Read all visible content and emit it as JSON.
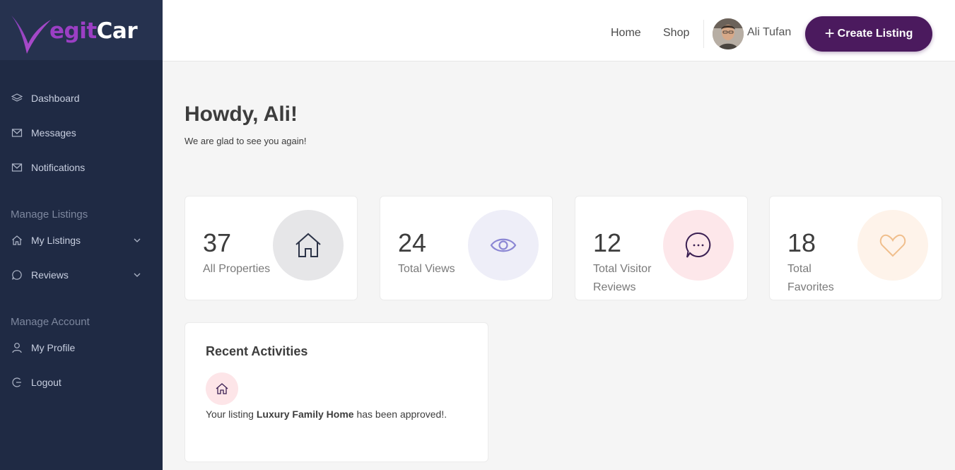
{
  "brand": {
    "logo_part1": "egit",
    "logo_part2": "Car"
  },
  "sidebar": {
    "items_top": [
      {
        "label": "Dashboard",
        "icon": "layers-icon"
      },
      {
        "label": "Messages",
        "icon": "mail-icon"
      },
      {
        "label": "Notifications",
        "icon": "mail-icon"
      }
    ],
    "section_listings": "Manage Listings",
    "items_listings": [
      {
        "label": "My Listings",
        "icon": "home-icon"
      },
      {
        "label": "Reviews",
        "icon": "chat-icon"
      }
    ],
    "section_account": "Manage Account",
    "items_account": [
      {
        "label": "My Profile",
        "icon": "user-icon"
      },
      {
        "label": "Logout",
        "icon": "logout-icon"
      }
    ]
  },
  "header": {
    "nav": [
      "Home",
      "Shop"
    ],
    "user_name": "Ali Tufan",
    "create_label": "Create Listing"
  },
  "main": {
    "greeting": "Howdy, Ali!",
    "subgreeting": "We are glad to see you again!",
    "stats": [
      {
        "value": "37",
        "label": "All Properties",
        "icon": "home-icon",
        "color": "#e6e6e8"
      },
      {
        "value": "24",
        "label": "Total Views",
        "icon": "eye-icon",
        "color": "#eeeef8"
      },
      {
        "value": "12",
        "label": "Total Visitor Reviews",
        "icon": "chat-icon",
        "color": "#fde7ea"
      },
      {
        "value": "18",
        "label": "Total Favorites",
        "icon": "heart-icon",
        "color": "#fef3ea"
      }
    ],
    "activities": {
      "title": "Recent Activities",
      "item_prefix": "Your listing ",
      "item_bold": "Luxury Family Home",
      "item_suffix": " has been approved!."
    }
  }
}
